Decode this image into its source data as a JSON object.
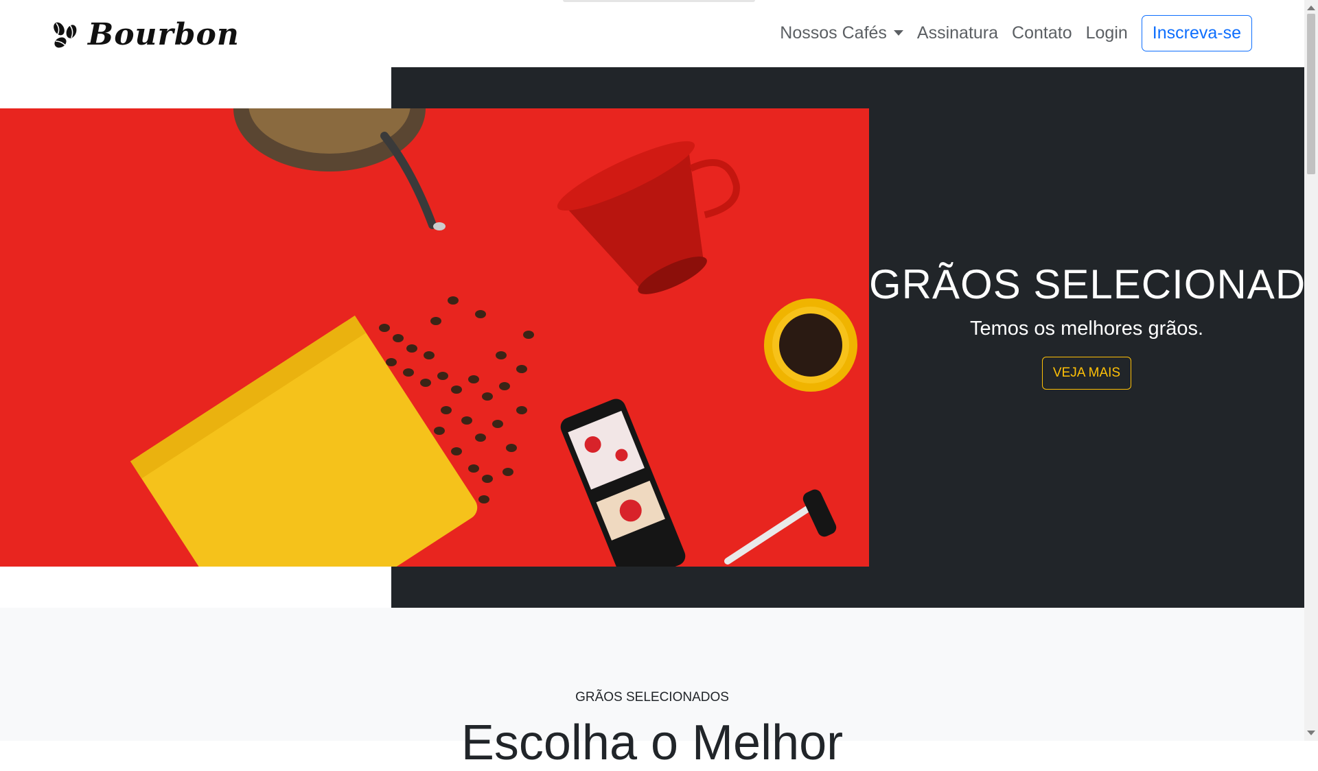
{
  "brand": {
    "name": "Bourbon",
    "icon": "coffee-beans-icon"
  },
  "nav": {
    "items": [
      {
        "label": "Nossos Cafés",
        "has_dropdown": true
      },
      {
        "label": "Assinatura"
      },
      {
        "label": "Contato"
      },
      {
        "label": "Login"
      }
    ],
    "cta_label": "Inscreva-se"
  },
  "hero": {
    "title": "GRÃOS SELECIONADOS.",
    "subtitle": "Temos os melhores grãos.",
    "button_label": "VEJA MAIS",
    "image": "coffee-flatlay-photo"
  },
  "section": {
    "eyebrow": "GRÃOS SELECIONADOS",
    "title": "Escolha o Melhor"
  },
  "colors": {
    "primary": "#0d6efd",
    "warning": "#ffc107",
    "dark": "#212529",
    "light": "#f8f9fa",
    "hero_red": "#e8251f",
    "bag_yellow": "#f5c21b"
  }
}
